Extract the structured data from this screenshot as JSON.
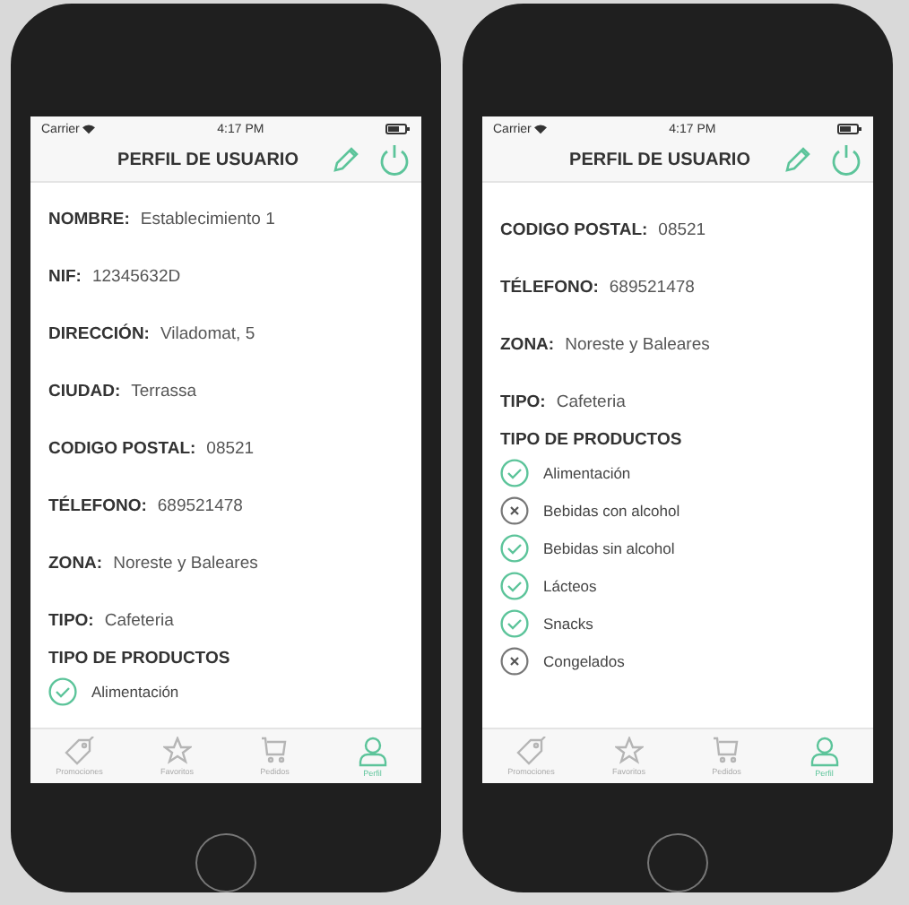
{
  "phones": [
    {
      "status_bar": {
        "carrier": "Carrier",
        "time": "4:17 PM"
      },
      "title": "PERFIL DE USUARIO",
      "fields": [
        {
          "label": "NOMBRE:",
          "value": "Establecimiento 1"
        },
        {
          "label": "NIF:",
          "value": "12345632D"
        },
        {
          "label": "DIRECCIÓN:",
          "value": "Viladomat, 5"
        },
        {
          "label": "CIUDAD:",
          "value": "Terrassa"
        },
        {
          "label": "CODIGO POSTAL:",
          "value": "08521"
        },
        {
          "label": "TÉLEFONO:",
          "value": "689521478"
        },
        {
          "label": "ZONA:",
          "value": "Noreste y Baleares"
        },
        {
          "label": "TIPO:",
          "value": "Cafeteria"
        }
      ],
      "products_heading": "TIPO DE PRODUCTOS",
      "products": [
        {
          "name": "Alimentación",
          "checked": true
        }
      ],
      "tabs": [
        {
          "label": "Promociones",
          "selected": false
        },
        {
          "label": "Favoritos",
          "selected": false
        },
        {
          "label": "Pedidos",
          "selected": false
        },
        {
          "label": "Perfil",
          "selected": true
        }
      ]
    },
    {
      "status_bar": {
        "carrier": "Carrier",
        "time": "4:17 PM"
      },
      "title": "PERFIL DE USUARIO",
      "fields": [
        {
          "label": "CODIGO POSTAL:",
          "value": "08521"
        },
        {
          "label": "TÉLEFONO:",
          "value": "689521478"
        },
        {
          "label": "ZONA:",
          "value": "Noreste y Baleares"
        },
        {
          "label": "TIPO:",
          "value": "Cafeteria"
        }
      ],
      "products_heading": "TIPO DE PRODUCTOS",
      "products": [
        {
          "name": "Alimentación",
          "checked": true
        },
        {
          "name": "Bebidas con alcohol",
          "checked": false
        },
        {
          "name": "Bebidas sin alcohol",
          "checked": true
        },
        {
          "name": "Lácteos",
          "checked": true
        },
        {
          "name": "Snacks",
          "checked": true
        },
        {
          "name": "Congelados",
          "checked": false
        }
      ],
      "tabs": [
        {
          "label": "Promociones",
          "selected": false
        },
        {
          "label": "Favoritos",
          "selected": false
        },
        {
          "label": "Pedidos",
          "selected": false
        },
        {
          "label": "Perfil",
          "selected": true
        }
      ]
    }
  ]
}
